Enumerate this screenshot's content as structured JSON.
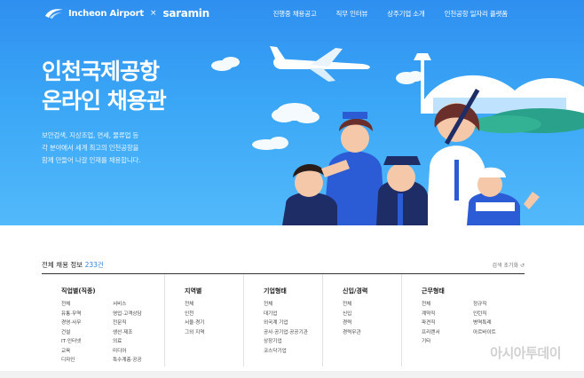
{
  "header": {
    "logo_text": "Incheon Airport",
    "logo_sep": "×",
    "brand": "saramin",
    "nav": [
      "진행중 채용공고",
      "직무 인터뷰",
      "상주기업 소개",
      "인천공항 일자리 플랫폼"
    ]
  },
  "hero": {
    "title_line1": "인천국제공항",
    "title_line2": "온라인 채용관",
    "desc_line1": "보안검색, 지상조업, 면세, 물류업 등",
    "desc_line2": "각 분야에서 세계 최고의 인천공항을",
    "desc_line3": "함께 만들어 나갈 인재를 채용합니다."
  },
  "filter": {
    "count_prefix": "전체 채용 정보",
    "count_value": "233건",
    "reset_label": "검색 초기화 ↺",
    "columns": [
      {
        "title": "직업별(직종)",
        "options": [
          "전체",
          "서비스",
          "유통·무역",
          "영업·고객상담",
          "경영·사무",
          "전문직",
          "건설",
          "생산·제조",
          "IT·인터넷",
          "의료",
          "교육",
          "미디어",
          "디자인",
          "특수계층·공공"
        ]
      },
      {
        "title": "지역별",
        "options": [
          "전체",
          "인천",
          "서울·경기",
          "그외 지역"
        ]
      },
      {
        "title": "기업형태",
        "options": [
          "전체",
          "대기업",
          "외국계 기업",
          "공사·공기업·공공기관",
          "상장기업",
          "코스닥기업"
        ]
      },
      {
        "title": "신입/경력",
        "options": [
          "전체",
          "신입",
          "경력",
          "경력무관"
        ]
      },
      {
        "title": "근무형태",
        "options": [
          "전체",
          "정규직",
          "계약직",
          "인턴직",
          "파견직",
          "병역특례",
          "프리랜서",
          "아르바이트",
          "기타"
        ]
      }
    ]
  },
  "watermark": "아시아투데이"
}
